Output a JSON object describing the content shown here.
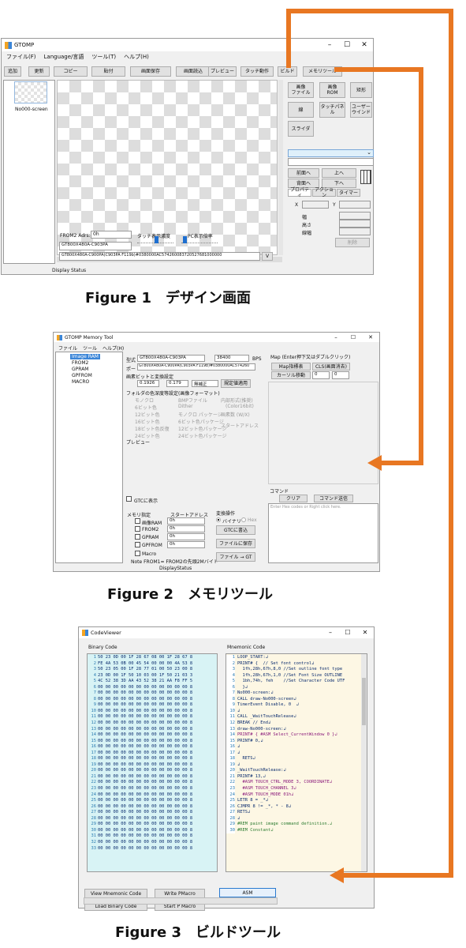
{
  "fig1": {
    "title": "GTOMP",
    "menu": [
      "ファイル(F)",
      "Language/言語",
      "ツール(T)",
      "ヘルプ(H)"
    ],
    "toolbar": [
      "追加",
      "更新",
      "コピー",
      "貼付",
      "画面保存",
      "画面読込",
      "プレビュー",
      "タッチ動作",
      "ビルド",
      "メモリツール"
    ],
    "screen_name": "No000-screen",
    "right_buttons": [
      "画像\nファイル",
      "画像\nROM",
      "矩形",
      "線",
      "タッチパネ\nル",
      "ユーザー\nウインド",
      "スライダ"
    ],
    "order_buttons": [
      "前面へ",
      "上へ",
      "背面へ",
      "下へ"
    ],
    "tabs": [
      "プロパティ",
      "アクション",
      "タイマー"
    ],
    "prop_labels": [
      "X",
      "Y",
      "幅",
      "高さ",
      "線幅"
    ],
    "delete_btn": "削除",
    "from2_label": "FROM2 Adrs:",
    "from2_value": "0h",
    "touch_label": "タッチ表示濃度",
    "pc_label": "PC表示倍率",
    "model_value": "GT800X480A-C903PA",
    "path_value": "GT800X480A-C900PA(C903PA F119b)#0380000AC574260083720527681000000",
    "path_btn": "V",
    "status": "Display Status",
    "caption": "Figure 1　デザイン画面"
  },
  "fig2": {
    "title": "GTOMP Memory Tool",
    "menu": [
      "ファイル",
      "ツール",
      "ヘルプ(H)"
    ],
    "tree": [
      "Image RAM",
      "FROM2",
      "GPRAM",
      "GPFROM",
      "MACRO"
    ],
    "model_label": "型式",
    "model_value": "GT800X480A-C903PA",
    "baud": "38400",
    "bps": "BPS",
    "port_label": "ポート",
    "port_value": "GT800X480A-C900PA(C903PA F119b)#0380000AC574260",
    "conv_label": "画素ビットと変換設定",
    "x_value": "0.1926",
    "y_value": "0.179",
    "mode_value": "無補正",
    "std_btn": "規定値適用",
    "folder_label": "フォルダの色深度等設定(画像フォーマット)",
    "opts_l": [
      "モノクロ",
      "6ビット色",
      "12ビット色",
      "16ビット色",
      "18ビット色反復",
      "24ビット色"
    ],
    "opts_m": [
      "BMPファイル",
      "Dither",
      "モノクロ パッケージ",
      "6ビット色パッケージ",
      "12ビット色パッケージ",
      "24ビット色パッケージ"
    ],
    "opts_r": [
      "内部形式(推奨)",
      "(Color16bit)",
      "画素数 (W/X)",
      "スタートアドレス"
    ],
    "preview": "プレビュー",
    "gtc_check": "GTCに表示",
    "map_label": "Map (Enter押下又はダブルクリック)",
    "map_btns": [
      "Map指標表",
      "CLS(画面消去)"
    ],
    "cursor_btn": "カーソル移動",
    "cursor_vals": [
      "0",
      "0"
    ],
    "cmd_label": "コマンド",
    "clear_btn": "クリア",
    "send_btn": "コマンド送信",
    "cmd_hint": "Enter Hex codes or Right click here.",
    "mem_label": "メモリ指定",
    "start_label": "スタートアドレス",
    "mems": [
      "画像RAM",
      "FROM2",
      "GPRAM",
      "GPFROM",
      "Macro"
    ],
    "mem_vals": [
      "0h",
      "0h",
      "0h",
      "0h"
    ],
    "note": "Note FROM1= FROM2の先頭2Mバイト",
    "conv_op": "変換操作",
    "binary": "バイナリ",
    "hex": "Hex",
    "write_btn": "GTCに書込",
    "save_btn": "ファイルに保存",
    "file_gt_btn": "ファイル → GT",
    "status": "DisplayStatus",
    "caption": "Figure 2　メモリツール"
  },
  "fig3": {
    "title": "CodeViewer",
    "binary_label": "Binary Code",
    "mnemonic_label": "Mnemonic Code",
    "binary_lines": [
      "50 23 0D 00 1F 28 67 08 00 1F 28 67 8",
      "FE 4A 53 0B 00 45 54 00 00 00 4A 53 8",
      "50 23 05 00 1F 28 77 01 00 50 23 00 8",
      "23 0D 00 1F 50 10 03 00 1F 50 21 03 3",
      "4C 52 38 3D AA 43 52 38 21 AA F8 FF 5",
      "00 00 00 00 00 00 00 00 00 00 00 00 8",
      "00 00 00 00 00 00 00 00 00 00 00 00 8",
      "00 00 00 00 00 00 00 00 00 00 00 00 8",
      "00 00 00 00 00 00 00 00 00 00 00 00 8",
      "00 00 00 00 00 00 00 00 00 00 00 00 8",
      "00 00 00 00 00 00 00 00 00 00 00 00 8",
      "00 00 00 00 00 00 00 00 00 00 00 00 8",
      "00 00 00 00 00 00 00 00 00 00 00 00 8",
      "00 00 00 00 00 00 00 00 00 00 00 00 8",
      "00 00 00 00 00 00 00 00 00 00 00 00 8",
      "00 00 00 00 00 00 00 00 00 00 00 00 8",
      "00 00 00 00 00 00 00 00 00 00 00 00 8",
      "00 00 00 00 00 00 00 00 00 00 00 00 8",
      "00 00 00 00 00 00 00 00 00 00 00 00 8",
      "00 00 00 00 00 00 00 00 00 00 00 00 8",
      "00 00 00 00 00 00 00 00 00 00 00 00 8",
      "00 00 00 00 00 00 00 00 00 00 00 00 8",
      "00 00 00 00 00 00 00 00 00 00 00 00 8",
      "00 00 00 00 00 00 00 00 00 00 00 00 8",
      "00 00 00 00 00 00 00 00 00 00 00 00 8",
      "00 00 00 00 00 00 00 00 00 00 00 00 8",
      "00 00 00 00 00 00 00 00 00 00 00 00 8",
      "00 00 00 00 00 00 00 00 00 00 00 00 8",
      "00 00 00 00 00 00 00 00 00 00 00 00 8",
      "00 00 00 00 00 00 00 00 00 00 00 00 8",
      "00 00 00 00 00 00 00 00 00 00 00 00 8",
      "00 00 00 00 00 00 00 00 00 00 00 00 8",
      "00 00 00 00 00 00 00 00 00 00 00 00 8"
    ],
    "mnemonic_lines": [
      "LOOP_START:↲",
      "PRINT# {  // Set font control↲",
      "  1fh,28h,67h,8,0 //Set outline font type",
      "  1fh,28h,67h,1,0 //Set Font Size OUTLINE",
      "  1bh,74h, feh    //Set Character Code UTF",
      "  }↲",
      "No000-screen:↲",
      "CALL draw-No000-screen↲",
      "TimerEvent Disable, 0  ↲",
      "↲",
      "CALL _WaitTouchRelease↲",
      "BREAK // End↲",
      "draw-No000-screen:↲",
      "PRINT# { #ASM Select_CurrentWindow 0 }↲",
      "PRINT# 0,↲",
      "↲",
      "↲",
      "  RETS↲",
      "↲",
      "_WaitTouchRelease:↲",
      "PRINT# 13,↲",
      "  #ASM TOUCH_CTRL_MODE 3, COORDINATE↲",
      "  #ASM TOUCH_CHANNEL 3↲",
      "  #ASM TOUCH_MODE 01h↲",
      "LETR 8 = _*↲",
      "CJMPR 8 != _*, * - 8↲",
      "RETS↲",
      "↲",
      "#REM paint image command definition.↲",
      "#REM Constant↲"
    ],
    "btns": [
      "View Mnemonic Code",
      "Write PMacro",
      "ASM",
      "Load Binary Code",
      "Start P Macro"
    ],
    "caption": "Figure 3　ビルドツール"
  },
  "accent": "#e87722"
}
